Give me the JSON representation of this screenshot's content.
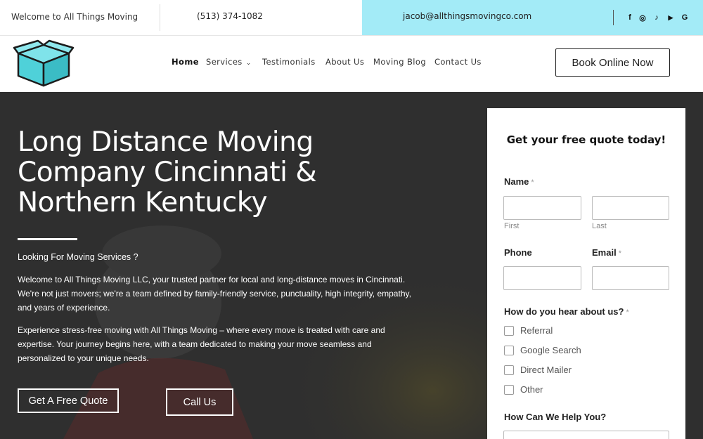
{
  "topbar": {
    "welcome": "Welcome to All Things Moving",
    "phone": "(513) 374-1082",
    "email": "jacob@allthingsmovingco.com",
    "social": [
      {
        "icon": "facebook-icon",
        "glyph": "f"
      },
      {
        "icon": "instagram-icon",
        "glyph": "◎"
      },
      {
        "icon": "tiktok-icon",
        "glyph": "♪"
      },
      {
        "icon": "youtube-icon",
        "glyph": "▶"
      },
      {
        "icon": "google-icon",
        "glyph": "G"
      }
    ]
  },
  "nav": {
    "items": [
      {
        "label": "Home",
        "active": true
      },
      {
        "label": "Services",
        "dropdown": true
      },
      {
        "label": "Testimonials"
      },
      {
        "label": "About Us"
      },
      {
        "label": "Moving Blog"
      },
      {
        "label": "Contact Us"
      }
    ],
    "cta": "Book Online Now"
  },
  "hero": {
    "title": "Long Distance Moving Company Cincinnati & Northern Kentucky",
    "subtitle": "Looking For Moving Services ?",
    "paragraph1": "Welcome to All Things Moving LLC, your trusted partner for local and long-distance moves in Cincinnati. We're not just movers; we're a team defined by family-friendly service, punctuality, high integrity, empathy, and years of experience.",
    "paragraph2": "Experience stress-free moving with All Things Moving – where every move is treated with care and expertise. Your journey begins here, with a team dedicated to making your move seamless and personalized to your unique needs.",
    "btn_quote": "Get A Free Quote",
    "btn_call": "Call Us"
  },
  "form": {
    "title": "Get your free quote today!",
    "name_label": "Name",
    "first_hint": "First",
    "last_hint": "Last",
    "phone_label": "Phone",
    "email_label": "Email",
    "required_mark": "*",
    "hear_label": "How do you hear about us?",
    "options": [
      "Referral",
      "Google Search",
      "Direct Mailer",
      "Other"
    ],
    "help_label": "How Can We Help You?"
  },
  "colors": {
    "topbar_accent": "#a3ebf7",
    "hero_bg": "#2f2f2f",
    "logo_teal": "#4fd1d9"
  }
}
